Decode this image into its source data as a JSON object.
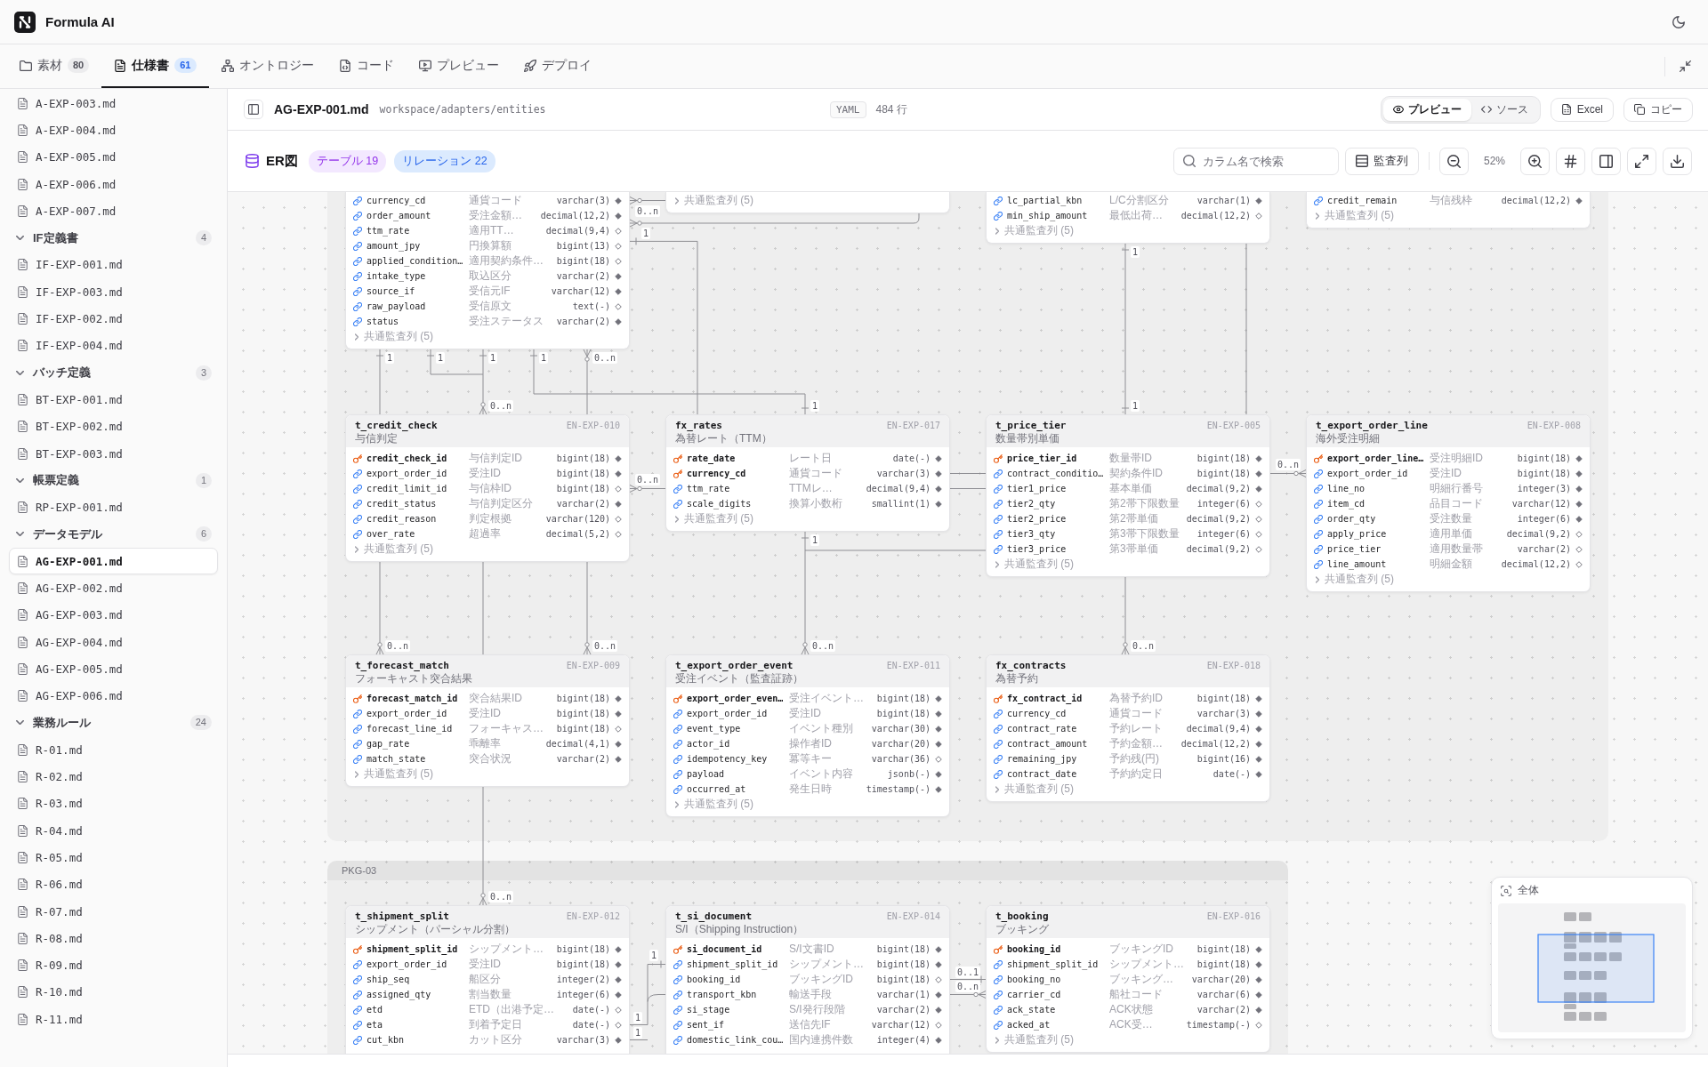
{
  "app": {
    "title": "Formula AI"
  },
  "tabs": [
    {
      "kind": "folder",
      "label": "素材",
      "count": "80",
      "selected": false
    },
    {
      "kind": "document",
      "label": "仕様書",
      "count": "61",
      "selected": true
    },
    {
      "kind": "network",
      "label": "オントロジー",
      "selected": false
    },
    {
      "kind": "code",
      "label": "コード",
      "selected": false
    },
    {
      "kind": "preview",
      "label": "プレビュー",
      "selected": false
    },
    {
      "kind": "deploy",
      "label": "デプロイ",
      "selected": false
    }
  ],
  "sidebar": {
    "items": [
      {
        "kind": "file",
        "label": "A-EXP-003.md",
        "selected": false
      },
      {
        "kind": "file",
        "label": "A-EXP-004.md",
        "selected": false
      },
      {
        "kind": "file",
        "label": "A-EXP-005.md",
        "selected": false
      },
      {
        "kind": "file",
        "label": "A-EXP-006.md",
        "selected": false
      },
      {
        "kind": "file",
        "label": "A-EXP-007.md",
        "selected": false
      },
      {
        "kind": "group",
        "label": "IF定義書",
        "count": "4",
        "expanded": true,
        "children": [
          {
            "kind": "file",
            "label": "IF-EXP-001.md",
            "selected": false
          },
          {
            "kind": "file",
            "label": "IF-EXP-003.md",
            "selected": false
          },
          {
            "kind": "file",
            "label": "IF-EXP-002.md",
            "selected": false
          },
          {
            "kind": "file",
            "label": "IF-EXP-004.md",
            "selected": false
          }
        ]
      },
      {
        "kind": "group",
        "label": "バッチ定義",
        "count": "3",
        "expanded": true,
        "children": [
          {
            "kind": "file",
            "label": "BT-EXP-001.md",
            "selected": false
          },
          {
            "kind": "file",
            "label": "BT-EXP-002.md",
            "selected": false
          },
          {
            "kind": "file",
            "label": "BT-EXP-003.md",
            "selected": false
          }
        ]
      },
      {
        "kind": "group",
        "label": "帳票定義",
        "count": "1",
        "expanded": true,
        "children": [
          {
            "kind": "file",
            "label": "RP-EXP-001.md",
            "selected": false
          }
        ]
      },
      {
        "kind": "group",
        "label": "データモデル",
        "count": "6",
        "expanded": true,
        "children": [
          {
            "kind": "file",
            "label": "AG-EXP-001.md",
            "selected": true
          },
          {
            "kind": "file",
            "label": "AG-EXP-002.md",
            "selected": false
          },
          {
            "kind": "file",
            "label": "AG-EXP-003.md",
            "selected": false
          },
          {
            "kind": "file",
            "label": "AG-EXP-004.md",
            "selected": false
          },
          {
            "kind": "file",
            "label": "AG-EXP-005.md",
            "selected": false
          },
          {
            "kind": "file",
            "label": "AG-EXP-006.md",
            "selected": false
          }
        ]
      },
      {
        "kind": "group",
        "label": "業務ルール",
        "count": "24",
        "expanded": true,
        "children": [
          {
            "kind": "file",
            "label": "R-01.md",
            "selected": false
          },
          {
            "kind": "file",
            "label": "R-02.md",
            "selected": false
          },
          {
            "kind": "file",
            "label": "R-03.md",
            "selected": false
          },
          {
            "kind": "file",
            "label": "R-04.md",
            "selected": false
          },
          {
            "kind": "file",
            "label": "R-05.md",
            "selected": false
          },
          {
            "kind": "file",
            "label": "R-06.md",
            "selected": false
          },
          {
            "kind": "file",
            "label": "R-07.md",
            "selected": false
          },
          {
            "kind": "file",
            "label": "R-08.md",
            "selected": false
          },
          {
            "kind": "file",
            "label": "R-09.md",
            "selected": false
          },
          {
            "kind": "file",
            "label": "R-10.md",
            "selected": false
          },
          {
            "kind": "file",
            "label": "R-11.md",
            "selected": false
          }
        ]
      }
    ]
  },
  "file_header": {
    "name": "AG-EXP-001.md",
    "path": "workspace/adapters/entities",
    "format": "YAML",
    "line_count": "484 行",
    "view_modes": [
      {
        "kind": "preview",
        "label": "プレビュー",
        "selected": true
      },
      {
        "kind": "source",
        "label": "ソース",
        "selected": false
      }
    ],
    "actions": [
      {
        "kind": "excel",
        "label": "Excel"
      },
      {
        "kind": "copy",
        "label": "コピー"
      }
    ]
  },
  "er_toolbar": {
    "title": "ER図",
    "badges": [
      {
        "kind": "tables",
        "label": "テーブル 19"
      },
      {
        "kind": "relations",
        "label": "リレーション 22"
      }
    ],
    "search": {
      "placeholder": "カラム名で検索"
    },
    "audit_button": "監査列",
    "zoom_level": "52%"
  },
  "diagram": {
    "packages": [
      {
        "tables": [
          {
            "columns": [
              {
                "kind": "column",
                "name": "currency_cd",
                "description": "通貨コード",
                "type": "varchar(3)",
                "required": true
              },
              {
                "kind": "column",
                "name": "order_amount",
                "description": "受注金額…",
                "type": "decimal(12,2)",
                "required": true
              },
              {
                "kind": "column",
                "name": "ttm_rate",
                "description": "適用TT…",
                "type": "decimal(9,4)",
                "required": false
              },
              {
                "kind": "column",
                "name": "amount_jpy",
                "description": "円換算額",
                "type": "bigint(13)",
                "required": false
              },
              {
                "kind": "column",
                "name": "applied_condition…",
                "description": "適用契約条件…",
                "type": "bigint(18)",
                "required": false
              },
              {
                "kind": "column",
                "name": "intake_type",
                "description": "取込区分",
                "type": "varchar(2)",
                "required": true
              },
              {
                "kind": "column",
                "name": "source_if",
                "description": "受信元IF",
                "type": "varchar(12)",
                "required": true
              },
              {
                "kind": "column",
                "name": "raw_payload",
                "description": "受信原文",
                "type": "text(-)",
                "required": false
              },
              {
                "kind": "column",
                "name": "status",
                "description": "受注ステータス",
                "type": "varchar(2)",
                "required": true
              }
            ],
            "footer": "共通監査列 (5)"
          },
          {
            "footer": "共通監査列 (5)"
          },
          {
            "columns": [
              {
                "kind": "column",
                "name": "lc_partial_kbn",
                "description": "L/C分割区分",
                "type": "varchar(1)",
                "required": true
              },
              {
                "kind": "column",
                "name": "min_ship_amount",
                "description": "最低出荷…",
                "type": "decimal(12,2)",
                "required": false
              }
            ],
            "footer": "共通監査列 (5)"
          },
          {
            "columns": [
              {
                "kind": "column",
                "name": "credit_remain",
                "description": "与信残枠",
                "type": "decimal(12,2)",
                "required": true
              }
            ],
            "footer": "共通監査列 (5)"
          },
          {
            "name": "t_credit_check",
            "subtitle": "与信判定",
            "code": "EN-EXP-010",
            "columns": [
              {
                "kind": "primary_key",
                "name": "credit_check_id",
                "description": "与信判定ID",
                "type": "bigint(18)",
                "required": true
              },
              {
                "kind": "column",
                "name": "export_order_id",
                "description": "受注ID",
                "type": "bigint(18)",
                "required": true
              },
              {
                "kind": "column",
                "name": "credit_limit_id",
                "description": "与信枠ID",
                "type": "bigint(18)",
                "required": false
              },
              {
                "kind": "column",
                "name": "credit_status",
                "description": "与信判定区分",
                "type": "varchar(2)",
                "required": true
              },
              {
                "kind": "column",
                "name": "credit_reason",
                "description": "判定根拠",
                "type": "varchar(120)",
                "required": false
              },
              {
                "kind": "column",
                "name": "over_rate",
                "description": "超過率",
                "type": "decimal(5,2)",
                "required": false
              }
            ],
            "footer": "共通監査列 (5)"
          },
          {
            "name": "fx_rates",
            "subtitle": "為替レート（TTM）",
            "code": "EN-EXP-017",
            "columns": [
              {
                "kind": "primary_key",
                "name": "rate_date",
                "description": "レート日",
                "type": "date(-)",
                "required": true
              },
              {
                "kind": "primary_key",
                "name": "currency_cd",
                "description": "通貨コード",
                "type": "varchar(3)",
                "required": true
              },
              {
                "kind": "column",
                "name": "ttm_rate",
                "description": "TTMレ…",
                "type": "decimal(9,4)",
                "required": true
              },
              {
                "kind": "column",
                "name": "scale_digits",
                "description": "換算小数桁",
                "type": "smallint(1)",
                "required": true
              }
            ],
            "footer": "共通監査列 (5)"
          },
          {
            "name": "t_price_tier",
            "subtitle": "数量帯別単価",
            "code": "EN-EXP-005",
            "columns": [
              {
                "kind": "primary_key",
                "name": "price_tier_id",
                "description": "数量帯ID",
                "type": "bigint(18)",
                "required": true
              },
              {
                "kind": "column",
                "name": "contract_conditio…",
                "description": "契約条件ID",
                "type": "bigint(18)",
                "required": true
              },
              {
                "kind": "column",
                "name": "tier1_price",
                "description": "基本単価",
                "type": "decimal(9,2)",
                "required": true
              },
              {
                "kind": "column",
                "name": "tier2_qty",
                "description": "第2帯下限数量",
                "type": "integer(6)",
                "required": false
              },
              {
                "kind": "column",
                "name": "tier2_price",
                "description": "第2帯単価",
                "type": "decimal(9,2)",
                "required": false
              },
              {
                "kind": "column",
                "name": "tier3_qty",
                "description": "第3帯下限数量",
                "type": "integer(6)",
                "required": false
              },
              {
                "kind": "column",
                "name": "tier3_price",
                "description": "第3帯単価",
                "type": "decimal(9,2)",
                "required": false
              }
            ],
            "footer": "共通監査列 (5)"
          },
          {
            "name": "t_export_order_line",
            "subtitle": "海外受注明細",
            "code": "EN-EXP-008",
            "columns": [
              {
                "kind": "primary_key",
                "name": "export_order_line…",
                "description": "受注明細ID",
                "type": "bigint(18)",
                "required": true
              },
              {
                "kind": "column",
                "name": "export_order_id",
                "description": "受注ID",
                "type": "bigint(18)",
                "required": true
              },
              {
                "kind": "column",
                "name": "line_no",
                "description": "明細行番号",
                "type": "integer(3)",
                "required": true
              },
              {
                "kind": "column",
                "name": "item_cd",
                "description": "品目コード",
                "type": "varchar(12)",
                "required": true
              },
              {
                "kind": "column",
                "name": "order_qty",
                "description": "受注数量",
                "type": "integer(6)",
                "required": true
              },
              {
                "kind": "column",
                "name": "apply_price",
                "description": "適用単価",
                "type": "decimal(9,2)",
                "required": false
              },
              {
                "kind": "column",
                "name": "price_tier",
                "description": "適用数量帯",
                "type": "varchar(2)",
                "required": false
              },
              {
                "kind": "column",
                "name": "line_amount",
                "description": "明細金額",
                "type": "decimal(12,2)",
                "required": false
              }
            ],
            "footer": "共通監査列 (5)"
          },
          {
            "name": "t_forecast_match",
            "subtitle": "フォーキャスト突合結果",
            "code": "EN-EXP-009",
            "columns": [
              {
                "kind": "primary_key",
                "name": "forecast_match_id",
                "description": "突合結果ID",
                "type": "bigint(18)",
                "required": true
              },
              {
                "kind": "column",
                "name": "export_order_id",
                "description": "受注ID",
                "type": "bigint(18)",
                "required": true
              },
              {
                "kind": "column",
                "name": "forecast_line_id",
                "description": "フォーキャス…",
                "type": "bigint(18)",
                "required": false
              },
              {
                "kind": "column",
                "name": "gap_rate",
                "description": "乖離率",
                "type": "decimal(4,1)",
                "required": true
              },
              {
                "kind": "column",
                "name": "match_state",
                "description": "突合状況",
                "type": "varchar(2)",
                "required": true
              }
            ],
            "footer": "共通監査列 (5)"
          },
          {
            "name": "t_export_order_event",
            "subtitle": "受注イベント（監査証跡）",
            "code": "EN-EXP-011",
            "columns": [
              {
                "kind": "primary_key",
                "name": "export_order_even…",
                "description": "受注イベント…",
                "type": "bigint(18)",
                "required": true
              },
              {
                "kind": "column",
                "name": "export_order_id",
                "description": "受注ID",
                "type": "bigint(18)",
                "required": true
              },
              {
                "kind": "column",
                "name": "event_type",
                "description": "イベント種別",
                "type": "varchar(30)",
                "required": true
              },
              {
                "kind": "column",
                "name": "actor_id",
                "description": "操作者ID",
                "type": "varchar(20)",
                "required": true
              },
              {
                "kind": "column",
                "name": "idempotency_key",
                "description": "冪等キー",
                "type": "varchar(36)",
                "required": false
              },
              {
                "kind": "column",
                "name": "payload",
                "description": "イベント内容",
                "type": "jsonb(-)",
                "required": true
              },
              {
                "kind": "column",
                "name": "occurred_at",
                "description": "発生日時",
                "type": "timestamp(-)",
                "required": true
              }
            ],
            "footer": "共通監査列 (5)"
          },
          {
            "name": "fx_contracts",
            "subtitle": "為替予約",
            "code": "EN-EXP-018",
            "columns": [
              {
                "kind": "primary_key",
                "name": "fx_contract_id",
                "description": "為替予約ID",
                "type": "bigint(18)",
                "required": true
              },
              {
                "kind": "column",
                "name": "currency_cd",
                "description": "通貨コード",
                "type": "varchar(3)",
                "required": true
              },
              {
                "kind": "column",
                "name": "contract_rate",
                "description": "予約レート",
                "type": "decimal(9,4)",
                "required": true
              },
              {
                "kind": "column",
                "name": "contract_amount",
                "description": "予約金額…",
                "type": "decimal(12,2)",
                "required": true
              },
              {
                "kind": "column",
                "name": "remaining_jpy",
                "description": "予約残(円)",
                "type": "bigint(16)",
                "required": true
              },
              {
                "kind": "column",
                "name": "contract_date",
                "description": "予約約定日",
                "type": "date(-)",
                "required": true
              }
            ],
            "footer": "共通監査列 (5)"
          }
        ]
      },
      {
        "label": "PKG-03",
        "tables": [
          {
            "name": "t_shipment_split",
            "subtitle": "シップメント（パーシャル分割）",
            "code": "EN-EXP-012",
            "columns": [
              {
                "kind": "primary_key",
                "name": "shipment_split_id",
                "description": "シップメント…",
                "type": "bigint(18)",
                "required": true
              },
              {
                "kind": "column",
                "name": "export_order_id",
                "description": "受注ID",
                "type": "bigint(18)",
                "required": true
              },
              {
                "kind": "column",
                "name": "ship_seq",
                "description": "船区分",
                "type": "integer(2)",
                "required": true
              },
              {
                "kind": "column",
                "name": "assigned_qty",
                "description": "割当数量",
                "type": "integer(6)",
                "required": true
              },
              {
                "kind": "column",
                "name": "etd",
                "description": "ETD（出港予定…",
                "type": "date(-)",
                "required": false
              },
              {
                "kind": "column",
                "name": "eta",
                "description": "到着予定日",
                "type": "date(-)",
                "required": false
              },
              {
                "kind": "column",
                "name": "cut_kbn",
                "description": "カット区分",
                "type": "varchar(3)",
                "required": true
              }
            ]
          },
          {
            "name": "t_si_document",
            "subtitle": "S/I（Shipping Instruction）",
            "code": "EN-EXP-014",
            "columns": [
              {
                "kind": "primary_key",
                "name": "si_document_id",
                "description": "S/I文書ID",
                "type": "bigint(18)",
                "required": true
              },
              {
                "kind": "column",
                "name": "shipment_split_id",
                "description": "シップメント…",
                "type": "bigint(18)",
                "required": true
              },
              {
                "kind": "column",
                "name": "booking_id",
                "description": "ブッキングID",
                "type": "bigint(18)",
                "required": false
              },
              {
                "kind": "column",
                "name": "transport_kbn",
                "description": "輸送手段",
                "type": "varchar(1)",
                "required": true
              },
              {
                "kind": "column",
                "name": "si_stage",
                "description": "S/I発行段階",
                "type": "varchar(2)",
                "required": true
              },
              {
                "kind": "column",
                "name": "sent_if",
                "description": "送信先IF",
                "type": "varchar(12)",
                "required": false
              },
              {
                "kind": "column",
                "name": "domestic_link_cou…",
                "description": "国内連携件数",
                "type": "integer(4)",
                "required": true
              }
            ]
          },
          {
            "name": "t_booking",
            "subtitle": "ブッキング",
            "code": "EN-EXP-016",
            "columns": [
              {
                "kind": "primary_key",
                "name": "booking_id",
                "description": "ブッキングID",
                "type": "bigint(18)",
                "required": true
              },
              {
                "kind": "column",
                "name": "shipment_split_id",
                "description": "シップメント…",
                "type": "bigint(18)",
                "required": true
              },
              {
                "kind": "column",
                "name": "booking_no",
                "description": "ブッキング…",
                "type": "varchar(20)",
                "required": true
              },
              {
                "kind": "column",
                "name": "carrier_cd",
                "description": "船社コード",
                "type": "varchar(6)",
                "required": true
              },
              {
                "kind": "column",
                "name": "ack_state",
                "description": "ACK状態",
                "type": "varchar(2)",
                "required": true
              },
              {
                "kind": "column",
                "name": "acked_at",
                "description": "ACK受…",
                "type": "timestamp(-)",
                "required": false
              }
            ],
            "footer": "共通監査列 (5)"
          }
        ]
      }
    ],
    "cardinality_labels": [
      "0..n",
      "1",
      "1",
      "1",
      "1",
      "1",
      "0..n",
      "1",
      "0..n",
      "1",
      "1",
      "0..n",
      "0..n",
      "1",
      "0..n",
      "0..n",
      "0..n",
      "0..n",
      "0..n",
      "1",
      "1",
      "1",
      "0..1",
      "0..n"
    ],
    "minimap": {
      "title": "全体"
    }
  }
}
